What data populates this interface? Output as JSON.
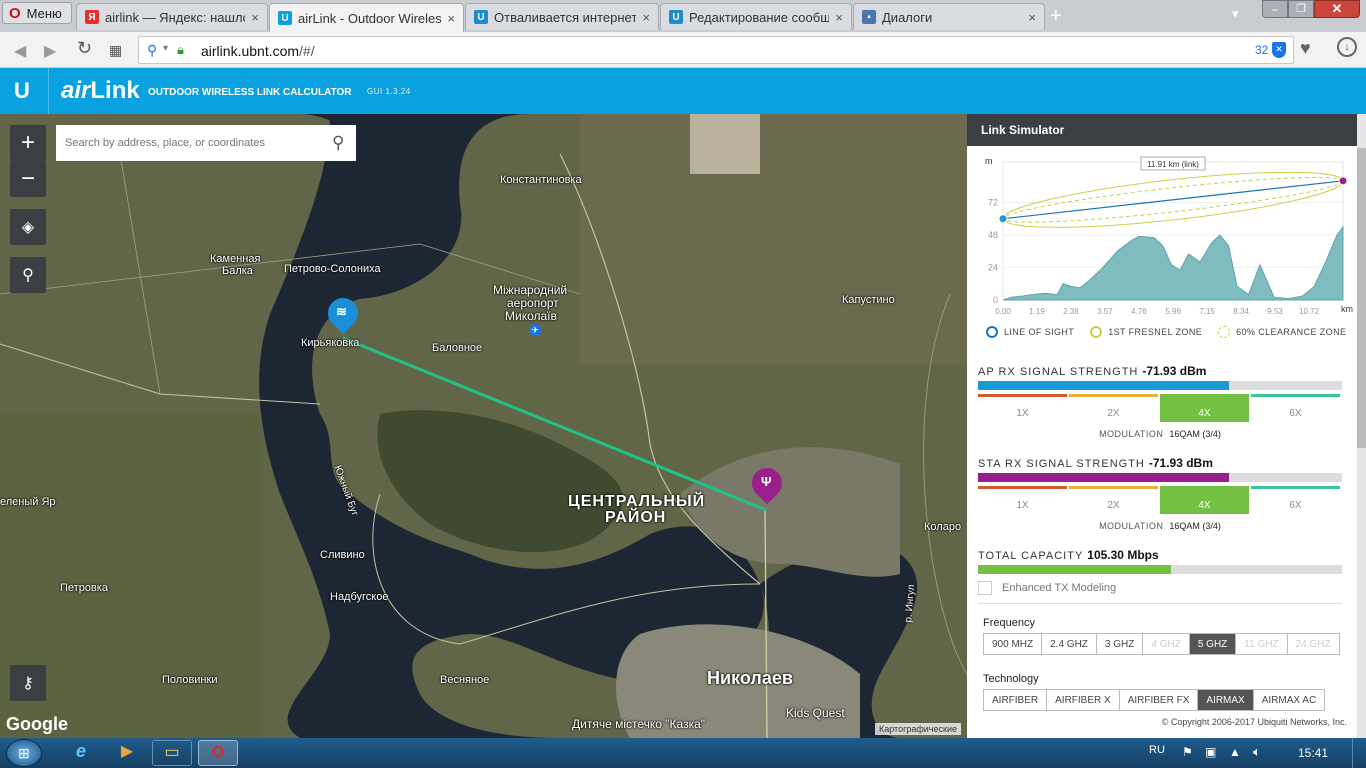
{
  "browser": {
    "menu_label": "Меню",
    "tabs": [
      {
        "title": "airlink — Яндекс: нашлось",
        "icon": "yandex-icon",
        "color": "#e62e2e",
        "active": false
      },
      {
        "title": "airLink - Outdoor Wireless",
        "icon": "ubnt-icon",
        "color": "#0aa1e0",
        "active": true
      },
      {
        "title": "Отваливается интернет |",
        "icon": "ubnt-icon",
        "color": "#1e8bd0",
        "active": false
      },
      {
        "title": "Редактирование сообщени",
        "icon": "ubnt-icon",
        "color": "#1e8bd0",
        "active": false
      },
      {
        "title": "Диалоги",
        "icon": "chat-icon",
        "color": "#4a76a8",
        "active": false
      }
    ],
    "url_domain": "airlink.ubnt.com",
    "url_path": "/#/",
    "adblock_count": "32"
  },
  "app": {
    "brand_air": "air",
    "brand_link": "Link",
    "tagline": "OUTDOOR WIRELESS LINK CALCULATOR",
    "version": "GUI 1.3.24"
  },
  "map": {
    "search_placeholder": "Search by address, place, or coordinates",
    "labels": {
      "konstantinovka": "Константиновка",
      "kamennaya_balka_1": "Каменная",
      "kamennaya_balka_2": "Балка",
      "petrovo": "Петрово-Солониха",
      "airport_1": "Міжнародний",
      "airport_2": "аеропорт",
      "airport_3": "Миколаїв",
      "kapustino": "Капустино",
      "kiryakovka": "Кирьяковка",
      "balovnoe": "Баловное",
      "zeleny_yar": "еленый Яр",
      "central_1": "ЦЕНТРАЛЬНЫЙ",
      "central_2": "РАЙОН",
      "kolarovo": "Коларо",
      "yuzhny_bug": "Южный Буг",
      "slivino": "Сливино",
      "petrovka": "Петровка",
      "nadbugskoe": "Надбугское",
      "ingul": "р. Ингул",
      "polovinki": "Половинки",
      "vesnyanoe": "Весняное",
      "nikolaev": "Николаев",
      "kids_quest": "Kids Quest",
      "kazka": "Дитяче містечко \"Казка\"",
      "google": "Google",
      "map_data": "Картографические"
    }
  },
  "simulator": {
    "title": "Link Simulator",
    "chart_unit_y": "m",
    "link_label": "11.91 km (link)",
    "y_ticks": [
      "72",
      "48",
      "24",
      "0"
    ],
    "x_ticks": [
      "0.00",
      "1.19",
      "2.38",
      "3.57",
      "4.76",
      "5.96",
      "7.15",
      "8.34",
      "9.53",
      "10.72"
    ],
    "x_unit": "km",
    "legend": {
      "los": "LINE OF SIGHT",
      "fresnel": "1ST FRESNEL ZONE",
      "clearance": "60% CLEARANCE ZONE"
    },
    "ap": {
      "label": "AP RX SIGNAL STRENGTH",
      "value": "-71.93 dBm",
      "fill_fraction": 0.69,
      "modulation_label": "MODULATION",
      "modulation": "16QAM (3/4)"
    },
    "sta": {
      "label": "STA RX SIGNAL STRENGTH",
      "value": "-71.93 dBm",
      "fill_fraction": 0.69,
      "modulation_label": "MODULATION",
      "modulation": "16QAM (3/4)"
    },
    "mod_levels": [
      "1X",
      "2X",
      "4X",
      "6X"
    ],
    "capacity": {
      "label": "TOTAL CAPACITY",
      "value": "105.30 Mbps",
      "fill_fraction": 0.53
    },
    "enhanced_tx": "Enhanced TX Modeling",
    "frequency_label": "Frequency",
    "frequencies": [
      "900 MHZ",
      "2.4 GHZ",
      "3 GHZ",
      "4 GHZ",
      "5 GHZ",
      "11 GHZ",
      "24 GHZ"
    ],
    "technology_label": "Technology",
    "technologies": [
      "AIRFIBER",
      "AIRFIBER X",
      "AIRFIBER FX",
      "AIRMAX",
      "AIRMAX AC"
    ],
    "copyright": "© Copyright 2006-2017 Ubiquiti Networks, Inc."
  },
  "chart_data": {
    "type": "area",
    "title": "",
    "xlabel": "km",
    "ylabel": "m",
    "ylim": [
      0,
      96
    ],
    "xlim": [
      0,
      11.91
    ],
    "series": [
      {
        "values": [
          [
            0,
            0
          ],
          [
            0.3,
            2
          ],
          [
            0.7,
            3
          ],
          [
            1.0,
            4
          ],
          [
            1.5,
            5
          ],
          [
            1.9,
            4
          ],
          [
            2.1,
            12
          ],
          [
            2.4,
            10
          ],
          [
            2.7,
            9
          ],
          [
            3.0,
            14
          ],
          [
            3.5,
            24
          ],
          [
            4.0,
            36
          ],
          [
            4.5,
            44
          ],
          [
            4.76,
            47
          ],
          [
            5.3,
            46
          ],
          [
            5.6,
            40
          ],
          [
            5.9,
            26
          ],
          [
            6.2,
            22
          ],
          [
            6.5,
            34
          ],
          [
            6.9,
            28
          ],
          [
            7.3,
            42
          ],
          [
            7.6,
            48
          ],
          [
            7.9,
            40
          ],
          [
            8.2,
            10
          ],
          [
            8.6,
            4
          ],
          [
            9.0,
            26
          ],
          [
            9.5,
            2
          ],
          [
            10.0,
            1
          ],
          [
            10.5,
            3
          ],
          [
            10.9,
            10
          ],
          [
            11.3,
            28
          ],
          [
            11.7,
            48
          ],
          [
            11.91,
            54
          ]
        ]
      }
    ],
    "line_of_sight": {
      "start_m": 60,
      "end_m": 88
    }
  },
  "taskbar": {
    "lang": "RU",
    "time": "15:41"
  }
}
